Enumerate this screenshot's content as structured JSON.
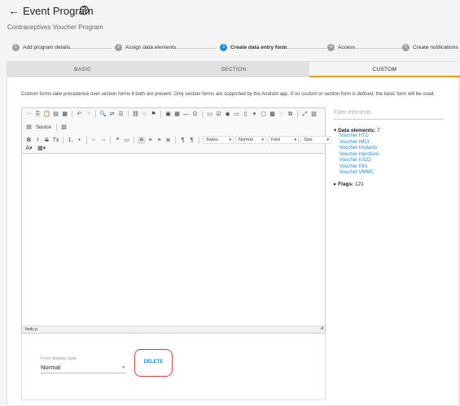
{
  "header": {
    "back_icon": "arrow-left-icon",
    "title": "Event Program",
    "help_icon": "help-circle-icon",
    "subtitle": "Contraceptives Voucher Program"
  },
  "stepper": {
    "steps": [
      {
        "num": "1",
        "label": "Add program details",
        "active": false
      },
      {
        "num": "2",
        "label": "Assign data elements",
        "active": false
      },
      {
        "num": "3",
        "label": "Create data entry form",
        "active": true
      },
      {
        "num": "4",
        "label": "Access",
        "active": false
      },
      {
        "num": "5",
        "label": "Create notifications",
        "active": false
      }
    ]
  },
  "tabs": [
    {
      "label": "BASIC",
      "active": false
    },
    {
      "label": "SECTION",
      "active": false
    },
    {
      "label": "CUSTOM",
      "active": true
    }
  ],
  "info_text": "Custom forms take precedence over section forms it both are present. Only section forms are supported by the Android app. If no custom or section form is defined, the basic form will be used.",
  "editor": {
    "source_label": "Source",
    "styles_label": "Styles",
    "format_label": "Normal",
    "font_label": "Font",
    "size_label": "Size",
    "status_path": "body  p"
  },
  "form_display": {
    "label": "Form display style",
    "value": "Normal",
    "delete_label": "DELETE"
  },
  "sidepanel": {
    "filter_placeholder": "Filter elements",
    "data_elements_label": "Data elements:",
    "data_elements_count": "7",
    "items": [
      "Voucher HTC",
      "Voucher IMCI",
      "Voucher Implants",
      "Voucher Injections",
      "Voucher IUCD",
      "Voucher Pills",
      "Voucher VMMC"
    ],
    "flags_label": "Flags:",
    "flags_count": "121"
  },
  "colors": {
    "accent": "#1e88e5",
    "tab_indicator": "#ff9800",
    "highlight": "#e53935"
  }
}
